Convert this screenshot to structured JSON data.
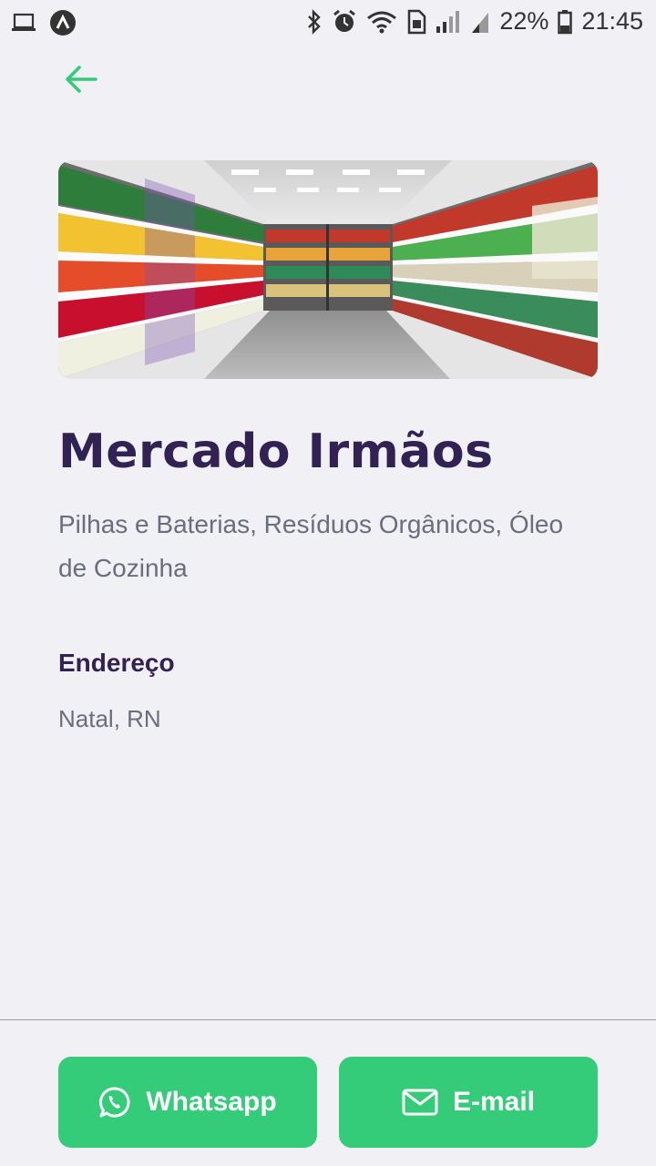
{
  "status_bar": {
    "battery": "22%",
    "time": "21:45"
  },
  "point": {
    "name": "Mercado Irmãos",
    "items": "Pilhas e Baterias, Resíduos Orgânicos, Óleo de Cozinha",
    "address_title": "Endereço",
    "address_value": "Natal, RN"
  },
  "actions": {
    "whatsapp_label": "Whatsapp",
    "email_label": "E-mail"
  },
  "colors": {
    "primary": "#34cb79",
    "title": "#322153",
    "text": "#6c6c80",
    "background": "#f0f0f5"
  },
  "icons": {
    "back": "arrow-left-icon",
    "whatsapp": "whatsapp-icon",
    "email": "mail-icon"
  }
}
